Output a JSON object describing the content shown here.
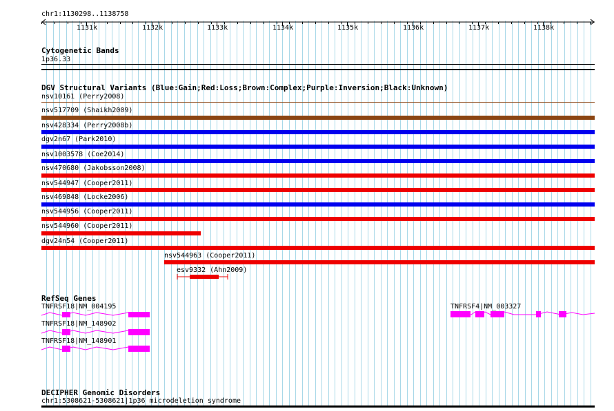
{
  "ruler": {
    "locus": "chr1:1130298..1138758",
    "ticks": [
      "1131k",
      "1132k",
      "1133k",
      "1134k",
      "1135k",
      "1136k",
      "1137k",
      "1138k"
    ]
  },
  "cytoband": {
    "title": "Cytogenetic Bands",
    "label": "1p36.33"
  },
  "dgv": {
    "title": "DGV Structural Variants (Blue:Gain;Red:Loss;Brown:Complex;Purple:Inversion;Black:Unknown)",
    "colors": {
      "gain": "#0000ee",
      "loss": "#ee0000",
      "complex": "#8b4513",
      "unknown": "#000000"
    },
    "items": [
      {
        "label": "nsv10161 (Perry2008)",
        "type": "complex"
      },
      {
        "label": "nsv517709 (Shaikh2009)",
        "type": "complex"
      },
      {
        "label": "nsv428334 (Perry2008b)",
        "type": "gain"
      },
      {
        "label": "dgv2n67 (Park2010)",
        "type": "gain"
      },
      {
        "label": "nsv1003578 (Coe2014)",
        "type": "gain"
      },
      {
        "label": "nsv470680 (Jakobsson2008)",
        "type": "loss"
      },
      {
        "label": "nsv544947 (Cooper2011)",
        "type": "loss"
      },
      {
        "label": "nsv469848 (Locke2006)",
        "type": "gain"
      },
      {
        "label": "nsv544956 (Cooper2011)",
        "type": "loss"
      },
      {
        "label": "nsv544960 (Cooper2011)",
        "type": "loss"
      },
      {
        "label": "dgv24n54 (Cooper2011)",
        "type": "loss"
      },
      {
        "label": "nsv544963 (Cooper2011)",
        "type": "loss"
      },
      {
        "label": "esv9332 (Ahn2009)",
        "type": "loss"
      }
    ]
  },
  "refseq": {
    "title": "RefSeq Genes",
    "color": "#ff00ff",
    "genes": [
      {
        "label": "TNFRSF18|NM_004195"
      },
      {
        "label": "TNFRSF18|NM_148902"
      },
      {
        "label": "TNFRSF18|NM_148901"
      },
      {
        "label": "TNFRSF4|NM_003327"
      }
    ]
  },
  "decipher": {
    "title": "DECIPHER Genomic Disorders",
    "label": "chr1:5308621-5308621|1p36 microdeletion syndrome"
  }
}
